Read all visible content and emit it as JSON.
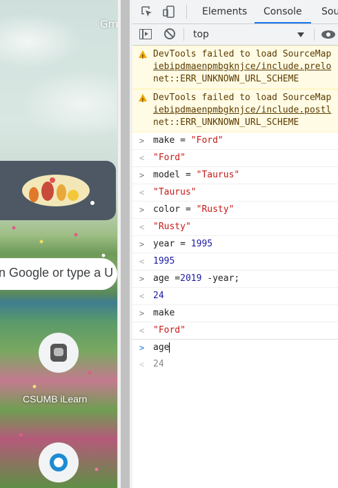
{
  "ntp": {
    "gmail_link": "Gm",
    "search_placeholder": "n Google or type a U",
    "shortcuts": [
      {
        "label": "CSUMB iLearn",
        "icon": "ilearn-icon"
      },
      {
        "label": "",
        "icon": "circle-logo-icon"
      }
    ]
  },
  "devtools": {
    "tabs": [
      "Elements",
      "Console",
      "Sou"
    ],
    "active_tab": "Console",
    "toolbar": {
      "context": "top"
    },
    "warnings": [
      {
        "line1": "DevTools failed to load SourceMap",
        "link": "iebipdmaenpmbgknjce/include.prelo",
        "line3": "net::ERR_UNKNOWN_URL_SCHEME"
      },
      {
        "line1": "DevTools failed to load SourceMap",
        "link": "iebipdmaenpmbgknjce/include.postl",
        "line3": "net::ERR_UNKNOWN_URL_SCHEME"
      }
    ],
    "entries": [
      {
        "cmd_pre": "make = ",
        "cmd_val": "\"Ford\"",
        "result": "\"Ford\""
      },
      {
        "cmd_pre": "model = ",
        "cmd_val": "\"Taurus\"",
        "result": "\"Taurus\""
      },
      {
        "cmd_pre": "color = ",
        "cmd_val": "\"Rusty\"",
        "result": "\"Rusty\""
      },
      {
        "cmd_pre": "year = ",
        "cmd_val": "1995",
        "result": "1995"
      },
      {
        "cmd_pre": "age =",
        "cmd_val": "2019",
        "cmd_post": " -year;",
        "result": "24"
      },
      {
        "cmd_pre": "make",
        "cmd_val": "",
        "result": "\"Ford\""
      }
    ],
    "prompt_input": "age",
    "eager_result": "24"
  }
}
